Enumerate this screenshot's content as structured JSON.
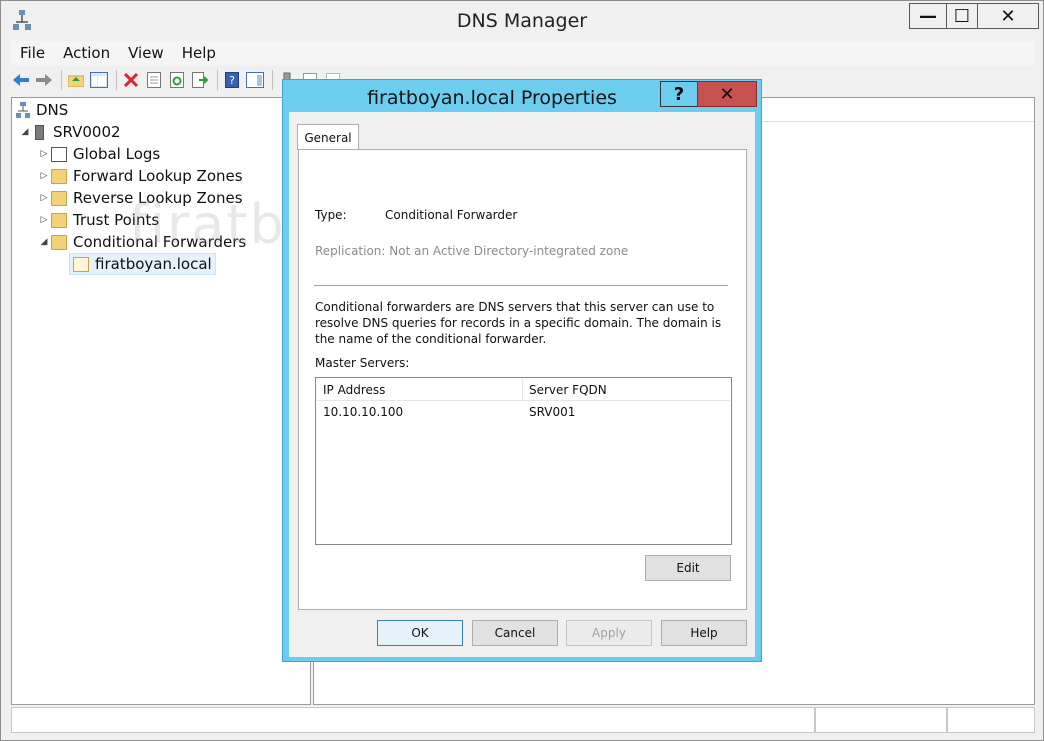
{
  "window": {
    "title": "DNS Manager",
    "controls": {
      "minimize": "—",
      "maximize": "☐",
      "close": "✕"
    }
  },
  "menu": [
    "File",
    "Action",
    "View",
    "Help"
  ],
  "toolbar": {
    "icons": [
      "back-icon",
      "forward-icon",
      "up-folder-icon",
      "show-hide-tree-icon",
      "delete-icon",
      "properties-icon",
      "refresh-icon",
      "export-list-icon",
      "help-icon",
      "action-pane-icon",
      "server-list-icon",
      "zone-icon",
      "record-icon"
    ]
  },
  "tree": {
    "root": "DNS",
    "server": "SRV0002",
    "items": [
      {
        "label": "Global Logs"
      },
      {
        "label": "Forward Lookup Zones"
      },
      {
        "label": "Reverse Lookup Zones"
      },
      {
        "label": "Trust Points"
      },
      {
        "label": "Conditional Forwarders"
      }
    ],
    "child": "firatboyan.local"
  },
  "watermark": "firatboyan.com",
  "dialog": {
    "title": "firatboyan.local Properties",
    "help": "?",
    "close": "✕",
    "tab": "General",
    "type_label": "Type:",
    "type_value": "Conditional Forwarder",
    "replication": "Replication: Not an Active Directory-integrated zone",
    "description": "Conditional forwarders are DNS servers that this server can use to resolve DNS queries for records in a specific domain.  The domain is the name of the conditional forwarder.",
    "master_label": "Master Servers:",
    "columns": [
      "IP Address",
      "Server FQDN"
    ],
    "rows": [
      {
        "ip": "10.10.10.100",
        "fqdn": "SRV001"
      }
    ],
    "edit": "Edit",
    "buttons": {
      "ok": "OK",
      "cancel": "Cancel",
      "apply": "Apply",
      "help": "Help"
    }
  }
}
